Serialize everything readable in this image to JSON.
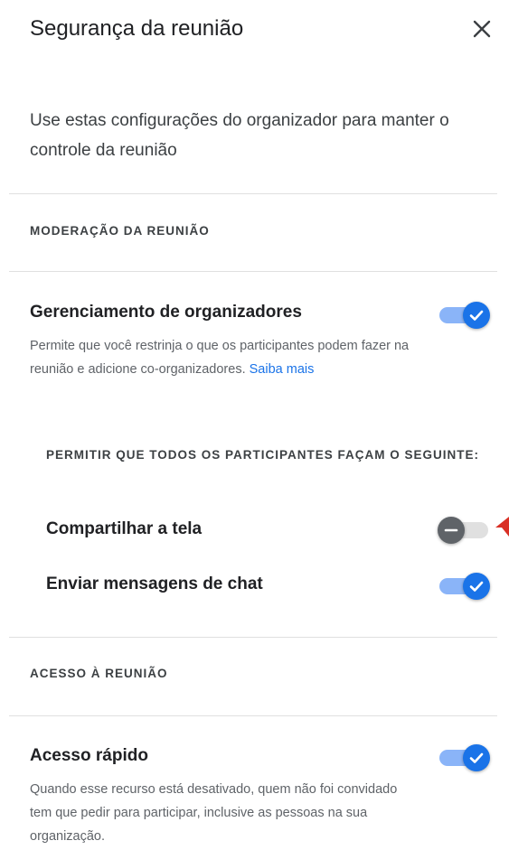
{
  "header": {
    "title": "Segurança da reunião",
    "close_icon": "close-icon"
  },
  "intro": {
    "text": "Use estas configurações do organizador para manter o controle da reunião"
  },
  "sections": {
    "moderation": {
      "label": "MODERAÇÃO DA REUNIÃO",
      "host_management": {
        "title": "Gerenciamento de organizadores",
        "description": "Permite que você restrinja o que os participantes podem fazer na reunião e adicione co-organizadores.",
        "link_text": "Saiba mais",
        "enabled": true
      },
      "allow_all_label": "PERMITIR QUE TODOS OS PARTICIPANTES FAÇAM O SEGUINTE:",
      "share_screen": {
        "label": "Compartilhar a tela",
        "enabled": false
      },
      "chat": {
        "label": "Enviar mensagens de chat",
        "enabled": true
      }
    },
    "access": {
      "label": "ACESSO À REUNIÃO",
      "quick_access": {
        "title": "Acesso rápido",
        "description": "Quando esse recurso está desativado, quem não foi convidado tem que pedir para participar, inclusive as pessoas na sua organização.",
        "enabled": true
      }
    }
  },
  "colors": {
    "accent": "#1a73e8",
    "accent_track": "#8ab4f8",
    "off_thumb": "#5f6368",
    "off_track": "#e0e0e0",
    "cursor": "#d93025"
  }
}
